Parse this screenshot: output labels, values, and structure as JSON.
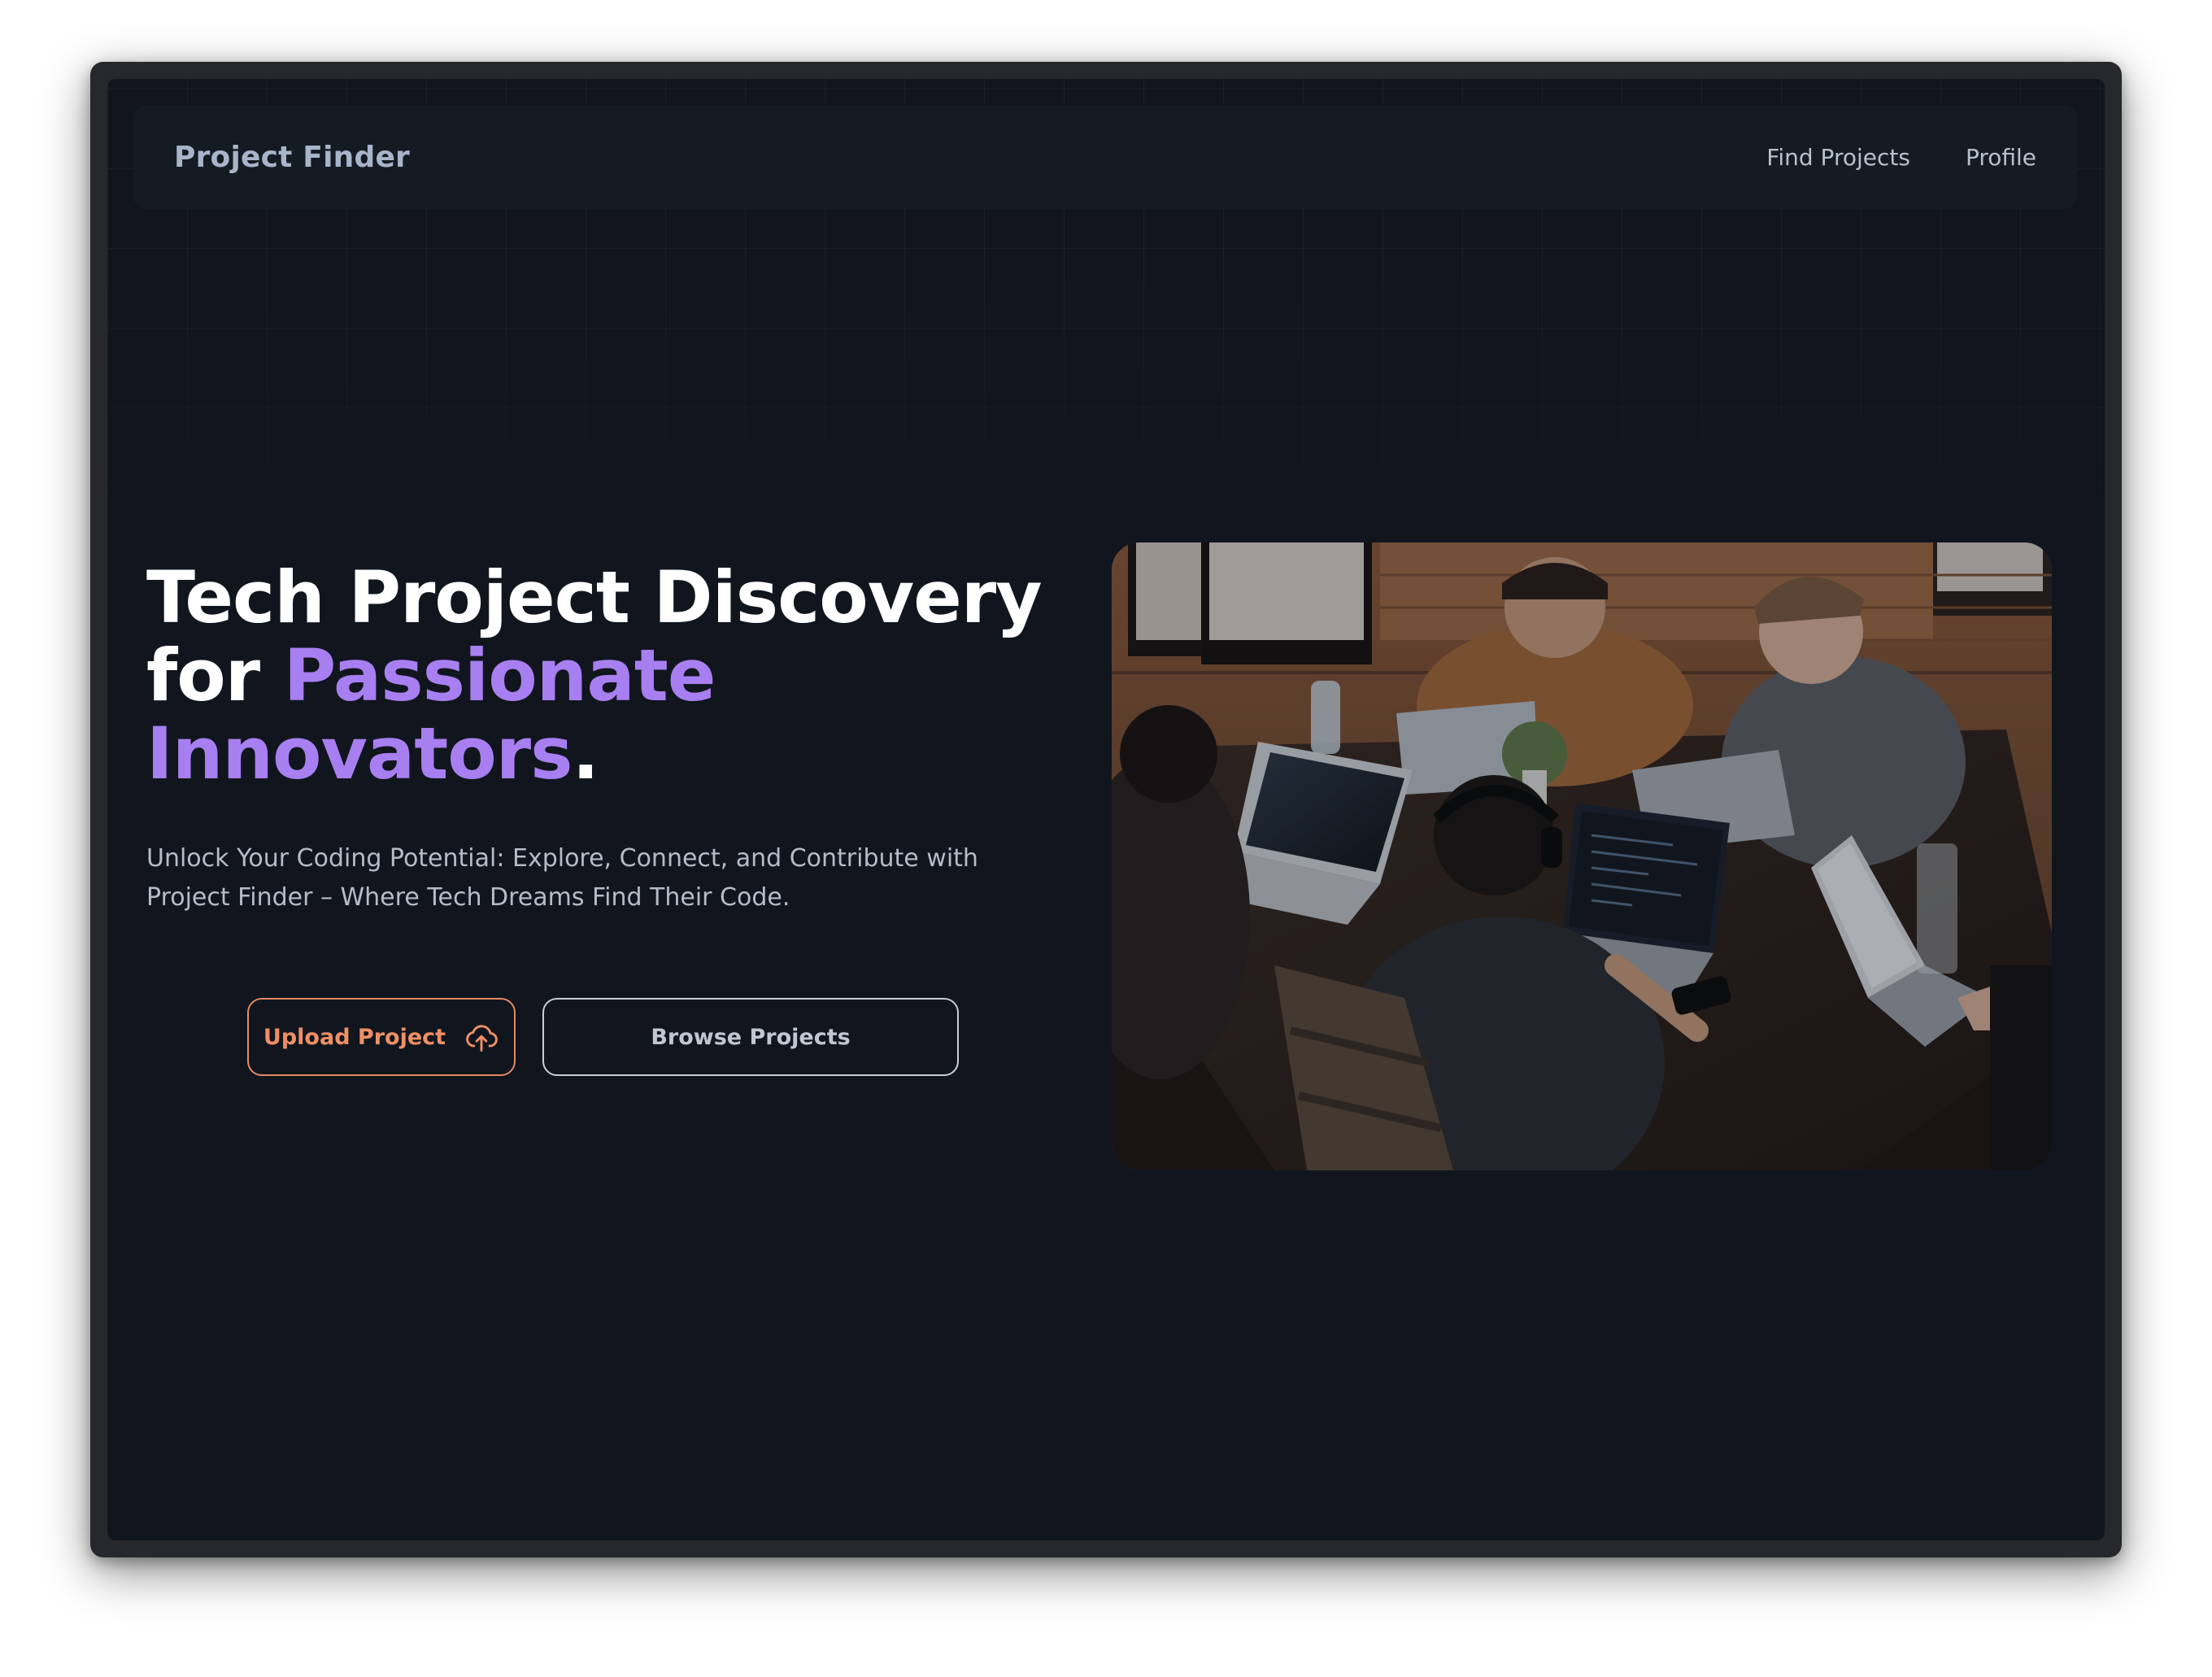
{
  "nav": {
    "brand": "Project Finder",
    "links": [
      "Find Projects",
      "Profile"
    ]
  },
  "hero": {
    "title_line1": "Tech Project Discovery",
    "title_for": "for ",
    "title_accent1": "Passionate",
    "title_accent2": "Innovators",
    "title_period": ".",
    "subtitle": "Unlock Your Coding Potential: Explore, Connect, and Contribute with Project Finder – Where Tech Dreams Find Their Code.",
    "upload_label": "Upload Project",
    "browse_label": "Browse Projects",
    "upload_icon": "cloud-upload-icon",
    "image_subject": "team-photo"
  },
  "colors": {
    "background": "#11161e",
    "navbar": "#151b23",
    "accent": "#a87ff0",
    "upload": "#ef8f65",
    "text_muted": "#b4bcc8"
  }
}
